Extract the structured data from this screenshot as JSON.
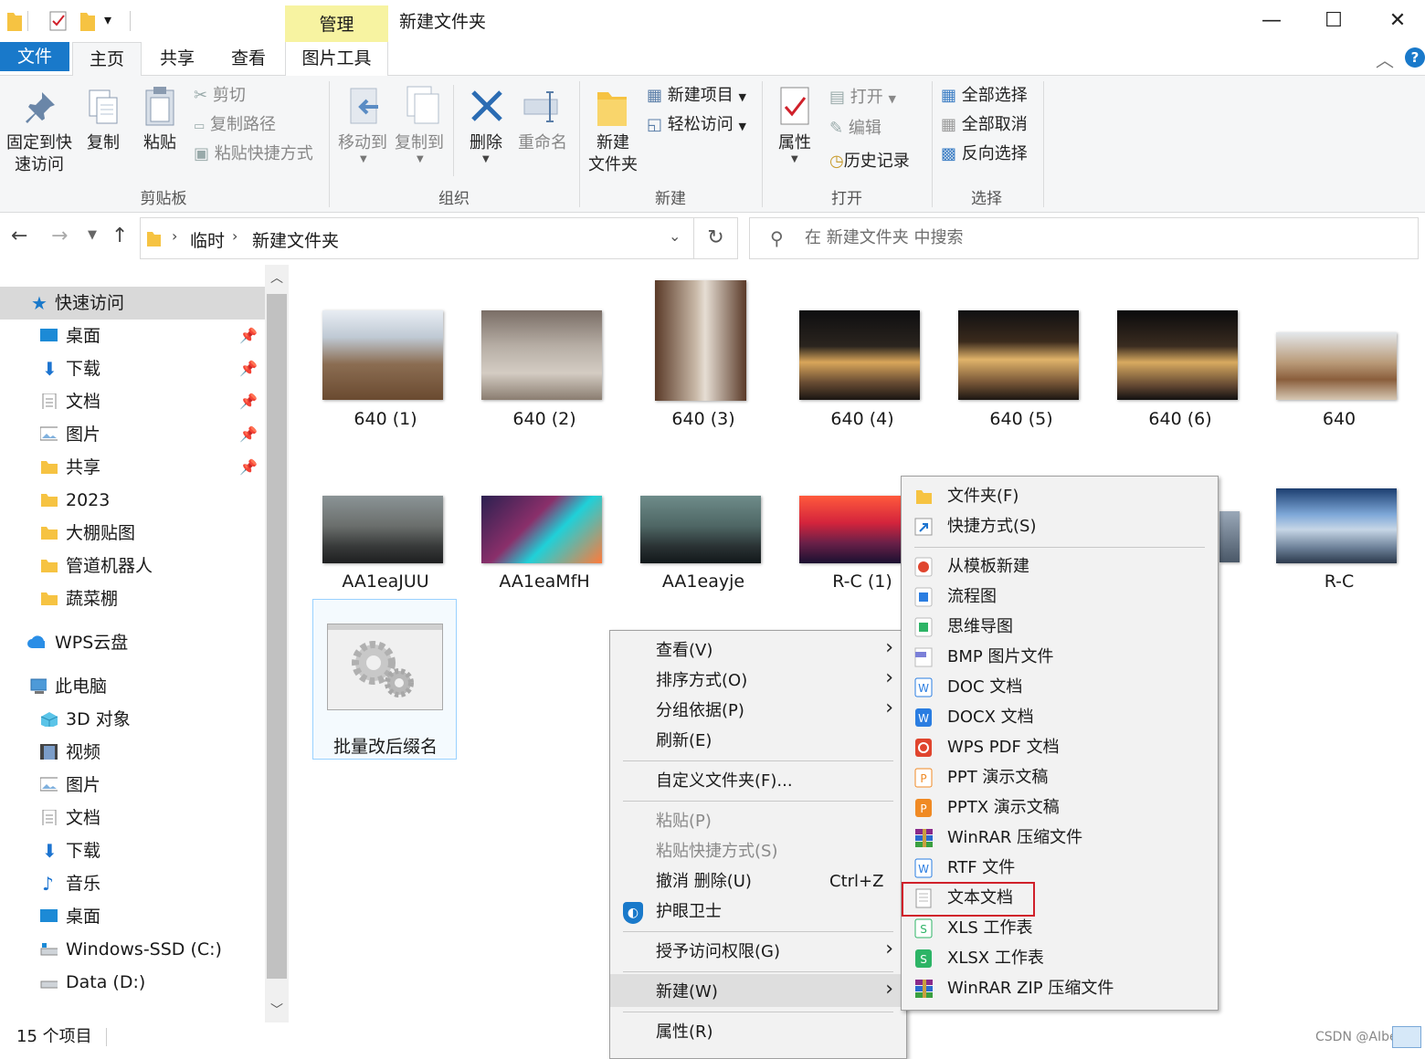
{
  "window": {
    "context_tab": "管理",
    "title": "新建文件夹",
    "minimize": "—",
    "maximize": "☐",
    "close": "✕"
  },
  "tabs": {
    "file": "文件",
    "home": "主页",
    "share": "共享",
    "view": "查看",
    "picture_tools": "图片工具"
  },
  "ribbon": {
    "clipboard": {
      "pin_label_1": "固定到快",
      "pin_label_2": "速访问",
      "copy": "复制",
      "paste": "粘贴",
      "cut": "剪切",
      "copy_path": "复制路径",
      "paste_shortcut": "粘贴快捷方式",
      "group": "剪贴板"
    },
    "organize": {
      "move_to": "移动到",
      "copy_to": "复制到",
      "delete": "删除",
      "rename": "重命名",
      "group": "组织"
    },
    "new": {
      "new_folder_1": "新建",
      "new_folder_2": "文件夹",
      "new_item": "新建项目",
      "easy_access": "轻松访问",
      "group": "新建"
    },
    "open": {
      "properties": "属性",
      "open": "打开",
      "edit": "编辑",
      "history": "历史记录",
      "group": "打开"
    },
    "select": {
      "select_all": "全部选择",
      "select_none": "全部取消",
      "invert": "反向选择",
      "group": "选择"
    }
  },
  "address": {
    "crumb1": "临时",
    "crumb2": "新建文件夹",
    "search_placeholder": "在 新建文件夹 中搜索"
  },
  "nav": {
    "quick_access": "快速访问",
    "qa_items": [
      "桌面",
      "下载",
      "文档",
      "图片",
      "共享",
      "2023",
      "大棚贴图",
      "管道机器人",
      "蔬菜棚"
    ],
    "wps": "WPS云盘",
    "this_pc": "此电脑",
    "pc_items": [
      "3D 对象",
      "视频",
      "图片",
      "文档",
      "下载",
      "音乐",
      "桌面",
      "Windows-SSD (C:)",
      "Data (D:)"
    ]
  },
  "files": [
    "640 (1)",
    "640 (2)",
    "640 (3)",
    "640 (4)",
    "640 (5)",
    "640 (6)",
    "640",
    "AA1eaJUU",
    "AA1eaMfH",
    "AA1eayje",
    "R-C (1)",
    "R-C",
    "批量改后缀名"
  ],
  "status": {
    "count": "15 个项目",
    "watermark": "CSDN @AIbest"
  },
  "context_menu": {
    "view": "查看(V)",
    "sort": "排序方式(O)",
    "group": "分组依据(P)",
    "refresh": "刷新(E)",
    "customize": "自定义文件夹(F)...",
    "paste": "粘贴(P)",
    "paste_shortcut": "粘贴快捷方式(S)",
    "undo": "撤消 删除(U)",
    "undo_shortcut": "Ctrl+Z",
    "guard": "护眼卫士",
    "grant": "授予访问权限(G)",
    "new": "新建(W)",
    "properties": "属性(R)"
  },
  "new_submenu": {
    "folder": "文件夹(F)",
    "shortcut": "快捷方式(S)",
    "items": [
      "从模板新建",
      "流程图",
      "思维导图",
      "BMP 图片文件",
      "DOC 文档",
      "DOCX 文档",
      "WPS PDF 文档",
      "PPT 演示文稿",
      "PPTX 演示文稿",
      "WinRAR 压缩文件",
      "RTF 文件",
      "文本文档",
      "XLS 工作表",
      "XLSX 工作表",
      "WinRAR ZIP 压缩文件"
    ]
  },
  "colors": {
    "accent": "#1979ca",
    "context_tab": "#f7f3a1",
    "highlight_box": "#d0202a"
  }
}
